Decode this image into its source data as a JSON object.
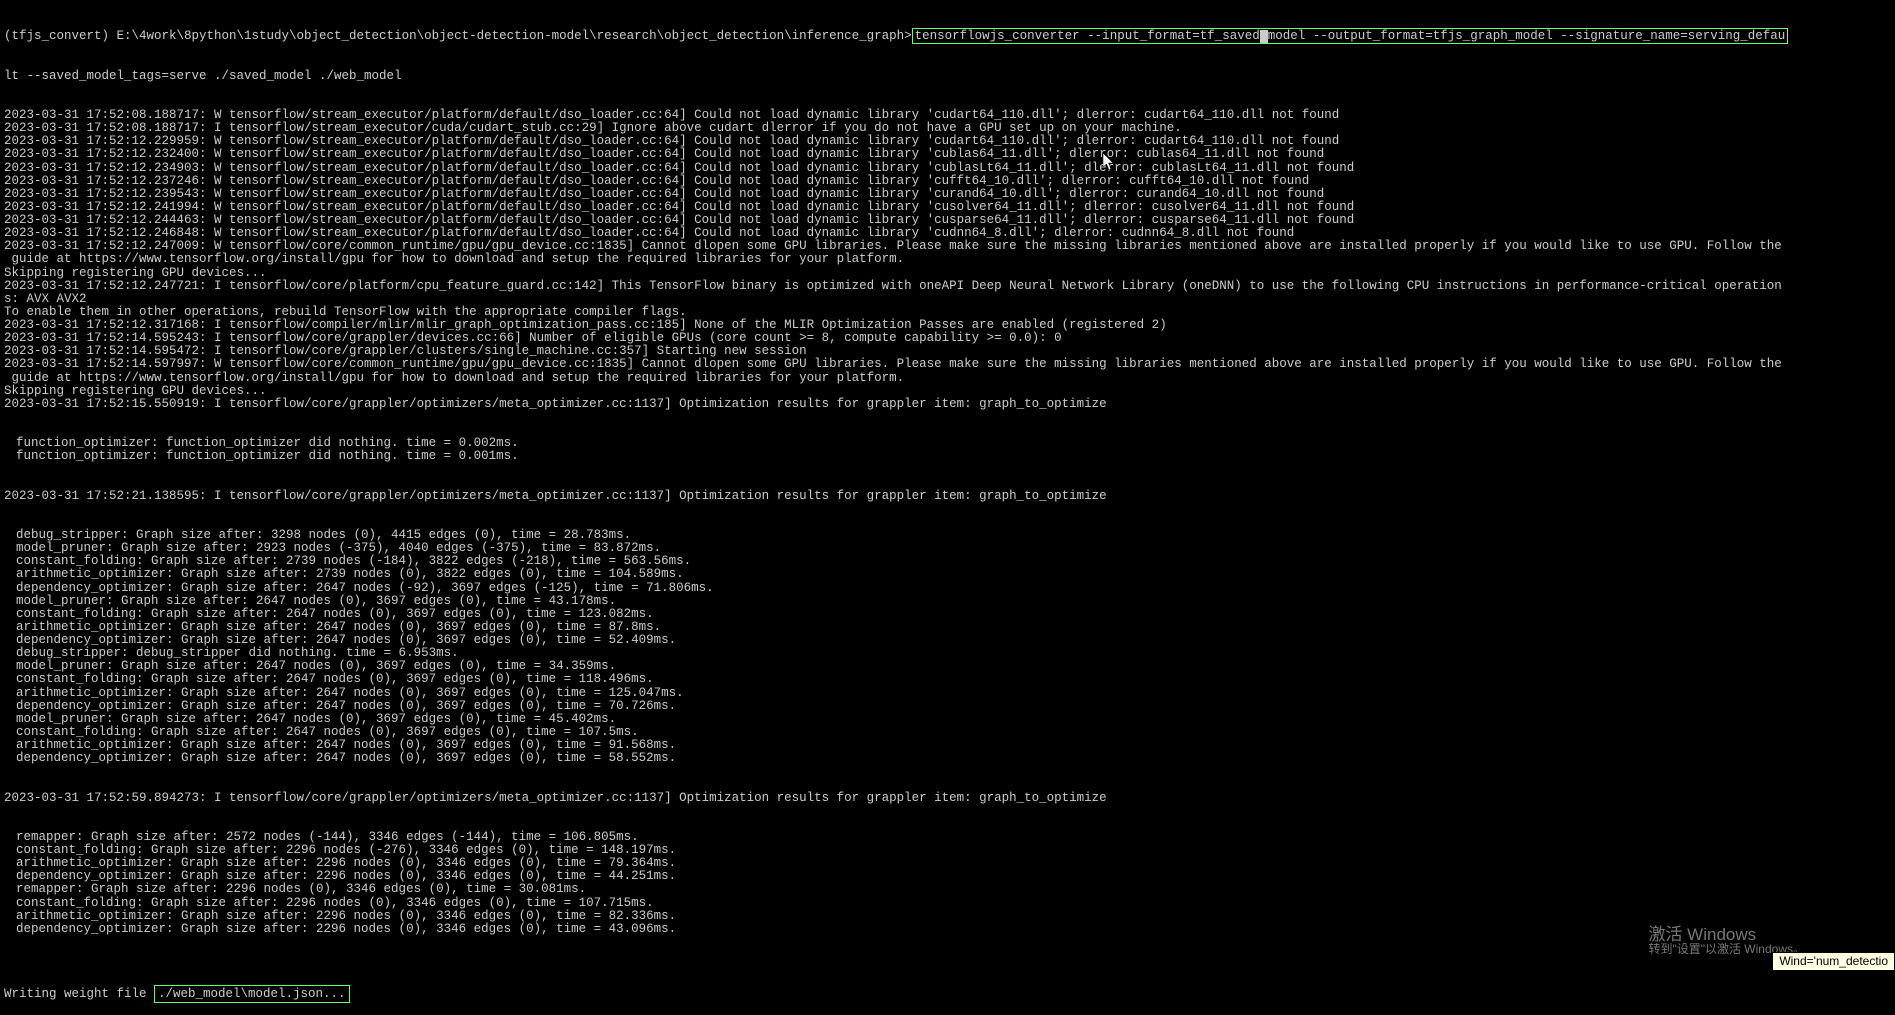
{
  "prompt": {
    "prefix": "(tfjs_convert) E:\\4work\\8python\\1study\\object_detection\\object-detection-model\\research\\object_detection\\inference_graph>",
    "command_part1": "tensorflowjs_converter --input_format=tf_saved",
    "command_part2": "model --output_format=tfjs_graph_model --signature_name=serving_defau",
    "continuation": "lt --saved_model_tags=serve ./saved_model ./web_model"
  },
  "logs": [
    "2023-03-31 17:52:08.188717: W tensorflow/stream_executor/platform/default/dso_loader.cc:64] Could not load dynamic library 'cudart64_110.dll'; dlerror: cudart64_110.dll not found",
    "2023-03-31 17:52:08.188717: I tensorflow/stream_executor/cuda/cudart_stub.cc:29] Ignore above cudart dlerror if you do not have a GPU set up on your machine.",
    "2023-03-31 17:52:12.229959: W tensorflow/stream_executor/platform/default/dso_loader.cc:64] Could not load dynamic library 'cudart64_110.dll'; dlerror: cudart64_110.dll not found",
    "2023-03-31 17:52:12.232400: W tensorflow/stream_executor/platform/default/dso_loader.cc:64] Could not load dynamic library 'cublas64_11.dll'; dlerror: cublas64_11.dll not found",
    "2023-03-31 17:52:12.234903: W tensorflow/stream_executor/platform/default/dso_loader.cc:64] Could not load dynamic library 'cublasLt64_11.dll'; dlerror: cublasLt64_11.dll not found",
    "2023-03-31 17:52:12.237246: W tensorflow/stream_executor/platform/default/dso_loader.cc:64] Could not load dynamic library 'cufft64_10.dll'; dlerror: cufft64_10.dll not found",
    "2023-03-31 17:52:12.239543: W tensorflow/stream_executor/platform/default/dso_loader.cc:64] Could not load dynamic library 'curand64_10.dll'; dlerror: curand64_10.dll not found",
    "2023-03-31 17:52:12.241994: W tensorflow/stream_executor/platform/default/dso_loader.cc:64] Could not load dynamic library 'cusolver64_11.dll'; dlerror: cusolver64_11.dll not found",
    "2023-03-31 17:52:12.244463: W tensorflow/stream_executor/platform/default/dso_loader.cc:64] Could not load dynamic library 'cusparse64_11.dll'; dlerror: cusparse64_11.dll not found",
    "2023-03-31 17:52:12.246848: W tensorflow/stream_executor/platform/default/dso_loader.cc:64] Could not load dynamic library 'cudnn64_8.dll'; dlerror: cudnn64_8.dll not found",
    "2023-03-31 17:52:12.247009: W tensorflow/core/common_runtime/gpu/gpu_device.cc:1835] Cannot dlopen some GPU libraries. Please make sure the missing libraries mentioned above are installed properly if you would like to use GPU. Follow the",
    " guide at https://www.tensorflow.org/install/gpu for how to download and setup the required libraries for your platform.",
    "Skipping registering GPU devices...",
    "2023-03-31 17:52:12.247721: I tensorflow/core/platform/cpu_feature_guard.cc:142] This TensorFlow binary is optimized with oneAPI Deep Neural Network Library (oneDNN) to use the following CPU instructions in performance-critical operation",
    "s: AVX AVX2",
    "To enable them in other operations, rebuild TensorFlow with the appropriate compiler flags.",
    "2023-03-31 17:52:12.317168: I tensorflow/compiler/mlir/mlir_graph_optimization_pass.cc:185] None of the MLIR Optimization Passes are enabled (registered 2)",
    "2023-03-31 17:52:14.595243: I tensorflow/core/grappler/devices.cc:66] Number of eligible GPUs (core count >= 8, compute capability >= 0.0): 0",
    "2023-03-31 17:52:14.595472: I tensorflow/core/grappler/clusters/single_machine.cc:357] Starting new session",
    "2023-03-31 17:52:14.597997: W tensorflow/core/common_runtime/gpu/gpu_device.cc:1835] Cannot dlopen some GPU libraries. Please make sure the missing libraries mentioned above are installed properly if you would like to use GPU. Follow the",
    " guide at https://www.tensorflow.org/install/gpu for how to download and setup the required libraries for your platform.",
    "Skipping registering GPU devices...",
    "2023-03-31 17:52:15.550919: I tensorflow/core/grappler/optimizers/meta_optimizer.cc:1137] Optimization results for grappler item: graph_to_optimize"
  ],
  "indented1": [
    "function_optimizer: function_optimizer did nothing. time = 0.002ms.",
    "function_optimizer: function_optimizer did nothing. time = 0.001ms."
  ],
  "logs2": [
    "",
    "2023-03-31 17:52:21.138595: I tensorflow/core/grappler/optimizers/meta_optimizer.cc:1137] Optimization results for grappler item: graph_to_optimize"
  ],
  "indented2": [
    "debug_stripper: Graph size after: 3298 nodes (0), 4415 edges (0), time = 28.783ms.",
    "model_pruner: Graph size after: 2923 nodes (-375), 4040 edges (-375), time = 83.872ms.",
    "constant_folding: Graph size after: 2739 nodes (-184), 3822 edges (-218), time = 563.56ms.",
    "arithmetic_optimizer: Graph size after: 2739 nodes (0), 3822 edges (0), time = 104.589ms.",
    "dependency_optimizer: Graph size after: 2647 nodes (-92), 3697 edges (-125), time = 71.806ms.",
    "model_pruner: Graph size after: 2647 nodes (0), 3697 edges (0), time = 43.178ms.",
    "constant_folding: Graph size after: 2647 nodes (0), 3697 edges (0), time = 123.082ms.",
    "arithmetic_optimizer: Graph size after: 2647 nodes (0), 3697 edges (0), time = 87.8ms.",
    "dependency_optimizer: Graph size after: 2647 nodes (0), 3697 edges (0), time = 52.409ms.",
    "debug_stripper: debug_stripper did nothing. time = 6.953ms.",
    "model_pruner: Graph size after: 2647 nodes (0), 3697 edges (0), time = 34.359ms.",
    "constant_folding: Graph size after: 2647 nodes (0), 3697 edges (0), time = 118.496ms.",
    "arithmetic_optimizer: Graph size after: 2647 nodes (0), 3697 edges (0), time = 125.047ms.",
    "dependency_optimizer: Graph size after: 2647 nodes (0), 3697 edges (0), time = 70.726ms.",
    "model_pruner: Graph size after: 2647 nodes (0), 3697 edges (0), time = 45.402ms.",
    "constant_folding: Graph size after: 2647 nodes (0), 3697 edges (0), time = 107.5ms.",
    "arithmetic_optimizer: Graph size after: 2647 nodes (0), 3697 edges (0), time = 91.568ms.",
    "dependency_optimizer: Graph size after: 2647 nodes (0), 3697 edges (0), time = 58.552ms."
  ],
  "logs3": [
    "",
    "2023-03-31 17:52:59.894273: I tensorflow/core/grappler/optimizers/meta_optimizer.cc:1137] Optimization results for grappler item: graph_to_optimize"
  ],
  "indented3": [
    "remapper: Graph size after: 2572 nodes (-144), 3346 edges (-144), time = 106.805ms.",
    "constant_folding: Graph size after: 2296 nodes (-276), 3346 edges (0), time = 148.197ms.",
    "arithmetic_optimizer: Graph size after: 2296 nodes (0), 3346 edges (0), time = 79.364ms.",
    "dependency_optimizer: Graph size after: 2296 nodes (0), 3346 edges (0), time = 44.251ms.",
    "remapper: Graph size after: 2296 nodes (0), 3346 edges (0), time = 30.081ms.",
    "constant_folding: Graph size after: 2296 nodes (0), 3346 edges (0), time = 107.715ms.",
    "arithmetic_optimizer: Graph size after: 2296 nodes (0), 3346 edges (0), time = 82.336ms.",
    "dependency_optimizer: Graph size after: 2296 nodes (0), 3346 edges (0), time = 43.096ms."
  ],
  "final": {
    "blank": "",
    "writing_prefix": "Writing weight file ",
    "writing_path": "./web_model\\model.json..."
  },
  "watermark": {
    "title": "激活 Windows",
    "subtitle": "转到\"设置\"以激活 Windows。"
  },
  "tooltip": "Wind='num_detectio"
}
